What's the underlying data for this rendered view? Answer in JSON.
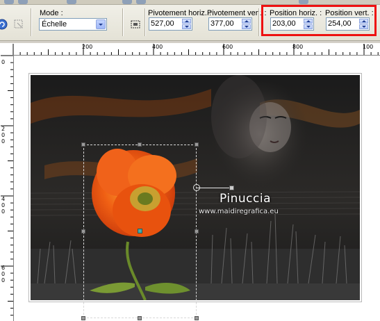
{
  "toolbar": {
    "mode_label": "Mode :",
    "mode_value": "Échelle",
    "pivot_h_label": "Pivotement horiz. :",
    "pivot_h_value": "527,00",
    "pivot_v_label": "Pivotement vert. :",
    "pivot_v_value": "377,00",
    "pos_h_label": "Position horiz. :",
    "pos_h_value": "203,00",
    "pos_v_label": "Position vert. :",
    "pos_v_value": "254,00"
  },
  "ruler": {
    "h_labels": [
      "200",
      "400",
      "600",
      "800",
      "100"
    ],
    "v_labels": [
      "0",
      "2\n0\n0",
      "4\n0\n0",
      "6\n0\n0"
    ]
  },
  "canvas": {
    "watermark_name": "Pinuccia",
    "watermark_url": "www.maidiregrafica.eu"
  },
  "colors": {
    "highlight": "#ee1111",
    "center_handle": "#4aa8a8",
    "poppy": "#f05a12"
  }
}
